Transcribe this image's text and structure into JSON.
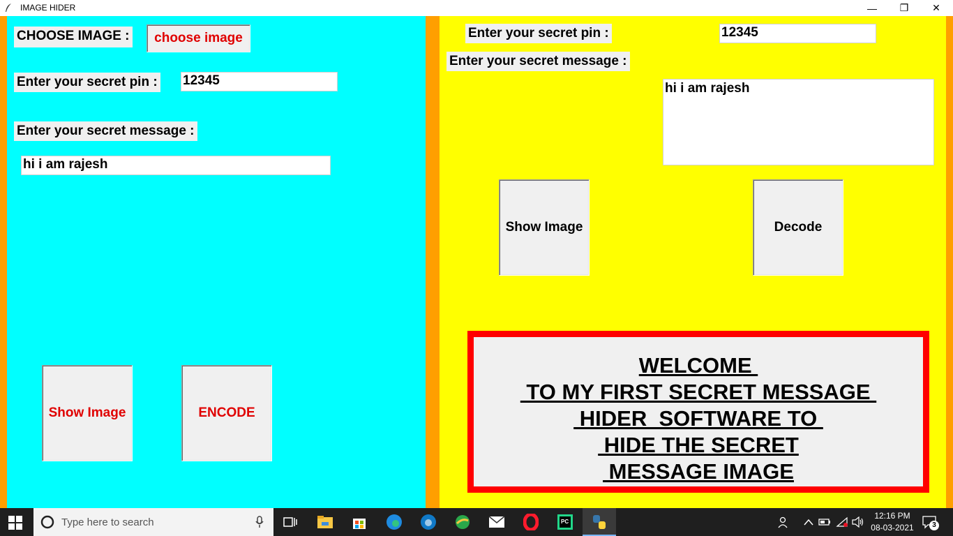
{
  "window": {
    "title": "IMAGE HIDER",
    "minimize_glyph": "—",
    "restore_glyph": "❐",
    "close_glyph": "✕"
  },
  "encode_panel": {
    "choose_label": "CHOOSE IMAGE :",
    "choose_button": "choose image",
    "pin_label": "Enter your secret pin :",
    "pin_value": "12345",
    "message_label": "Enter your secret message :",
    "message_value": "hi i am rajesh",
    "show_image_button": "Show Image",
    "encode_button": "ENCODE"
  },
  "decode_panel": {
    "pin_label": "Enter your secret pin :",
    "pin_value": "12345",
    "message_label": "Enter your secret message :",
    "message_value": "hi i am rajesh",
    "show_image_button": "Show Image",
    "decode_button": "Decode"
  },
  "welcome": {
    "line1": "WELCOME ",
    "line2": " TO MY FIRST SECRET MESSAGE ",
    "line3": " HIDER  SOFTWARE TO ",
    "line4": " HIDE THE SECRET",
    "line5": " MESSAGE IMAGE"
  },
  "taskbar": {
    "search_placeholder": "Type here to search",
    "time": "12:16 PM",
    "date": "08-03-2021",
    "notification_count": "3"
  },
  "colors": {
    "left_pane": "#00ffff",
    "right_pane": "#ffff00",
    "border": "#ff9f00",
    "accent_red": "#e00000",
    "welcome_border": "#ff0000"
  }
}
